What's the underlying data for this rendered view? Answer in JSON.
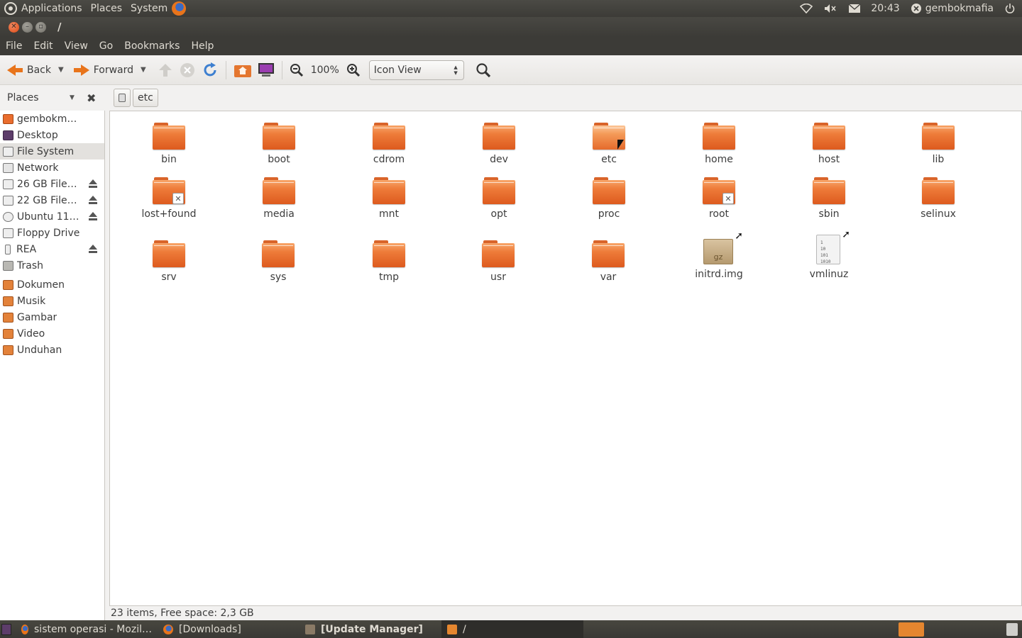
{
  "top_panel": {
    "menus": [
      "Applications",
      "Places",
      "System"
    ],
    "clock": "20:43",
    "user": "gembokmafia"
  },
  "window": {
    "title": "/"
  },
  "menubar": [
    "File",
    "Edit",
    "View",
    "Go",
    "Bookmarks",
    "Help"
  ],
  "toolbar": {
    "back": "Back",
    "forward": "Forward",
    "zoom": "100%",
    "view_mode": "Icon View"
  },
  "location": {
    "places_label": "Places",
    "crumb": "etc"
  },
  "sidebar": {
    "devices": [
      {
        "label": "gembokmafia",
        "icon": "home-folder-icon"
      },
      {
        "label": "Desktop",
        "icon": "desktop-icon"
      },
      {
        "label": "File System",
        "icon": "harddisk-icon",
        "selected": true
      },
      {
        "label": "Network",
        "icon": "network-icon"
      },
      {
        "label": "26 GB Files…",
        "icon": "harddisk-icon",
        "eject": true
      },
      {
        "label": "22 GB Files…",
        "icon": "harddisk-icon",
        "eject": true
      },
      {
        "label": "Ubuntu 11.…",
        "icon": "cdrom-icon",
        "eject": true
      },
      {
        "label": "Floppy Drive",
        "icon": "floppy-icon"
      },
      {
        "label": "REA",
        "icon": "usb-drive-icon",
        "eject": true
      },
      {
        "label": "Trash",
        "icon": "trash-icon"
      }
    ],
    "bookmarks": [
      {
        "label": "Dokumen",
        "icon": "folder-icon"
      },
      {
        "label": "Musik",
        "icon": "folder-icon"
      },
      {
        "label": "Gambar",
        "icon": "folder-icon"
      },
      {
        "label": "Video",
        "icon": "folder-icon"
      },
      {
        "label": "Unduhan",
        "icon": "folder-icon"
      }
    ]
  },
  "files": [
    {
      "name": "bin",
      "type": "folder"
    },
    {
      "name": "boot",
      "type": "folder"
    },
    {
      "name": "cdrom",
      "type": "folder"
    },
    {
      "name": "dev",
      "type": "folder"
    },
    {
      "name": "etc",
      "type": "folder",
      "hover": true
    },
    {
      "name": "home",
      "type": "folder"
    },
    {
      "name": "host",
      "type": "folder"
    },
    {
      "name": "lib",
      "type": "folder"
    },
    {
      "name": "lost+found",
      "type": "folder",
      "locked": true
    },
    {
      "name": "media",
      "type": "folder"
    },
    {
      "name": "mnt",
      "type": "folder"
    },
    {
      "name": "opt",
      "type": "folder"
    },
    {
      "name": "proc",
      "type": "folder"
    },
    {
      "name": "root",
      "type": "folder",
      "locked": true
    },
    {
      "name": "sbin",
      "type": "folder"
    },
    {
      "name": "selinux",
      "type": "folder"
    },
    {
      "name": "srv",
      "type": "folder"
    },
    {
      "name": "sys",
      "type": "folder"
    },
    {
      "name": "tmp",
      "type": "folder"
    },
    {
      "name": "usr",
      "type": "folder"
    },
    {
      "name": "var",
      "type": "folder"
    },
    {
      "name": "initrd.img",
      "type": "archive-link",
      "badge": "gz"
    },
    {
      "name": "vmlinuz",
      "type": "binary-link",
      "badge": "1\n10\n101\n1010"
    }
  ],
  "status": "23 items, Free space: 2,3 GB",
  "taskbar": [
    {
      "label": "sistem operasi - Mozil…",
      "icon": "firefox-icon"
    },
    {
      "label": "[Downloads]",
      "icon": "firefox-icon"
    },
    {
      "label": "[Update Manager]",
      "icon": "update-manager-icon"
    },
    {
      "label": "/",
      "icon": "folder-icon"
    }
  ]
}
